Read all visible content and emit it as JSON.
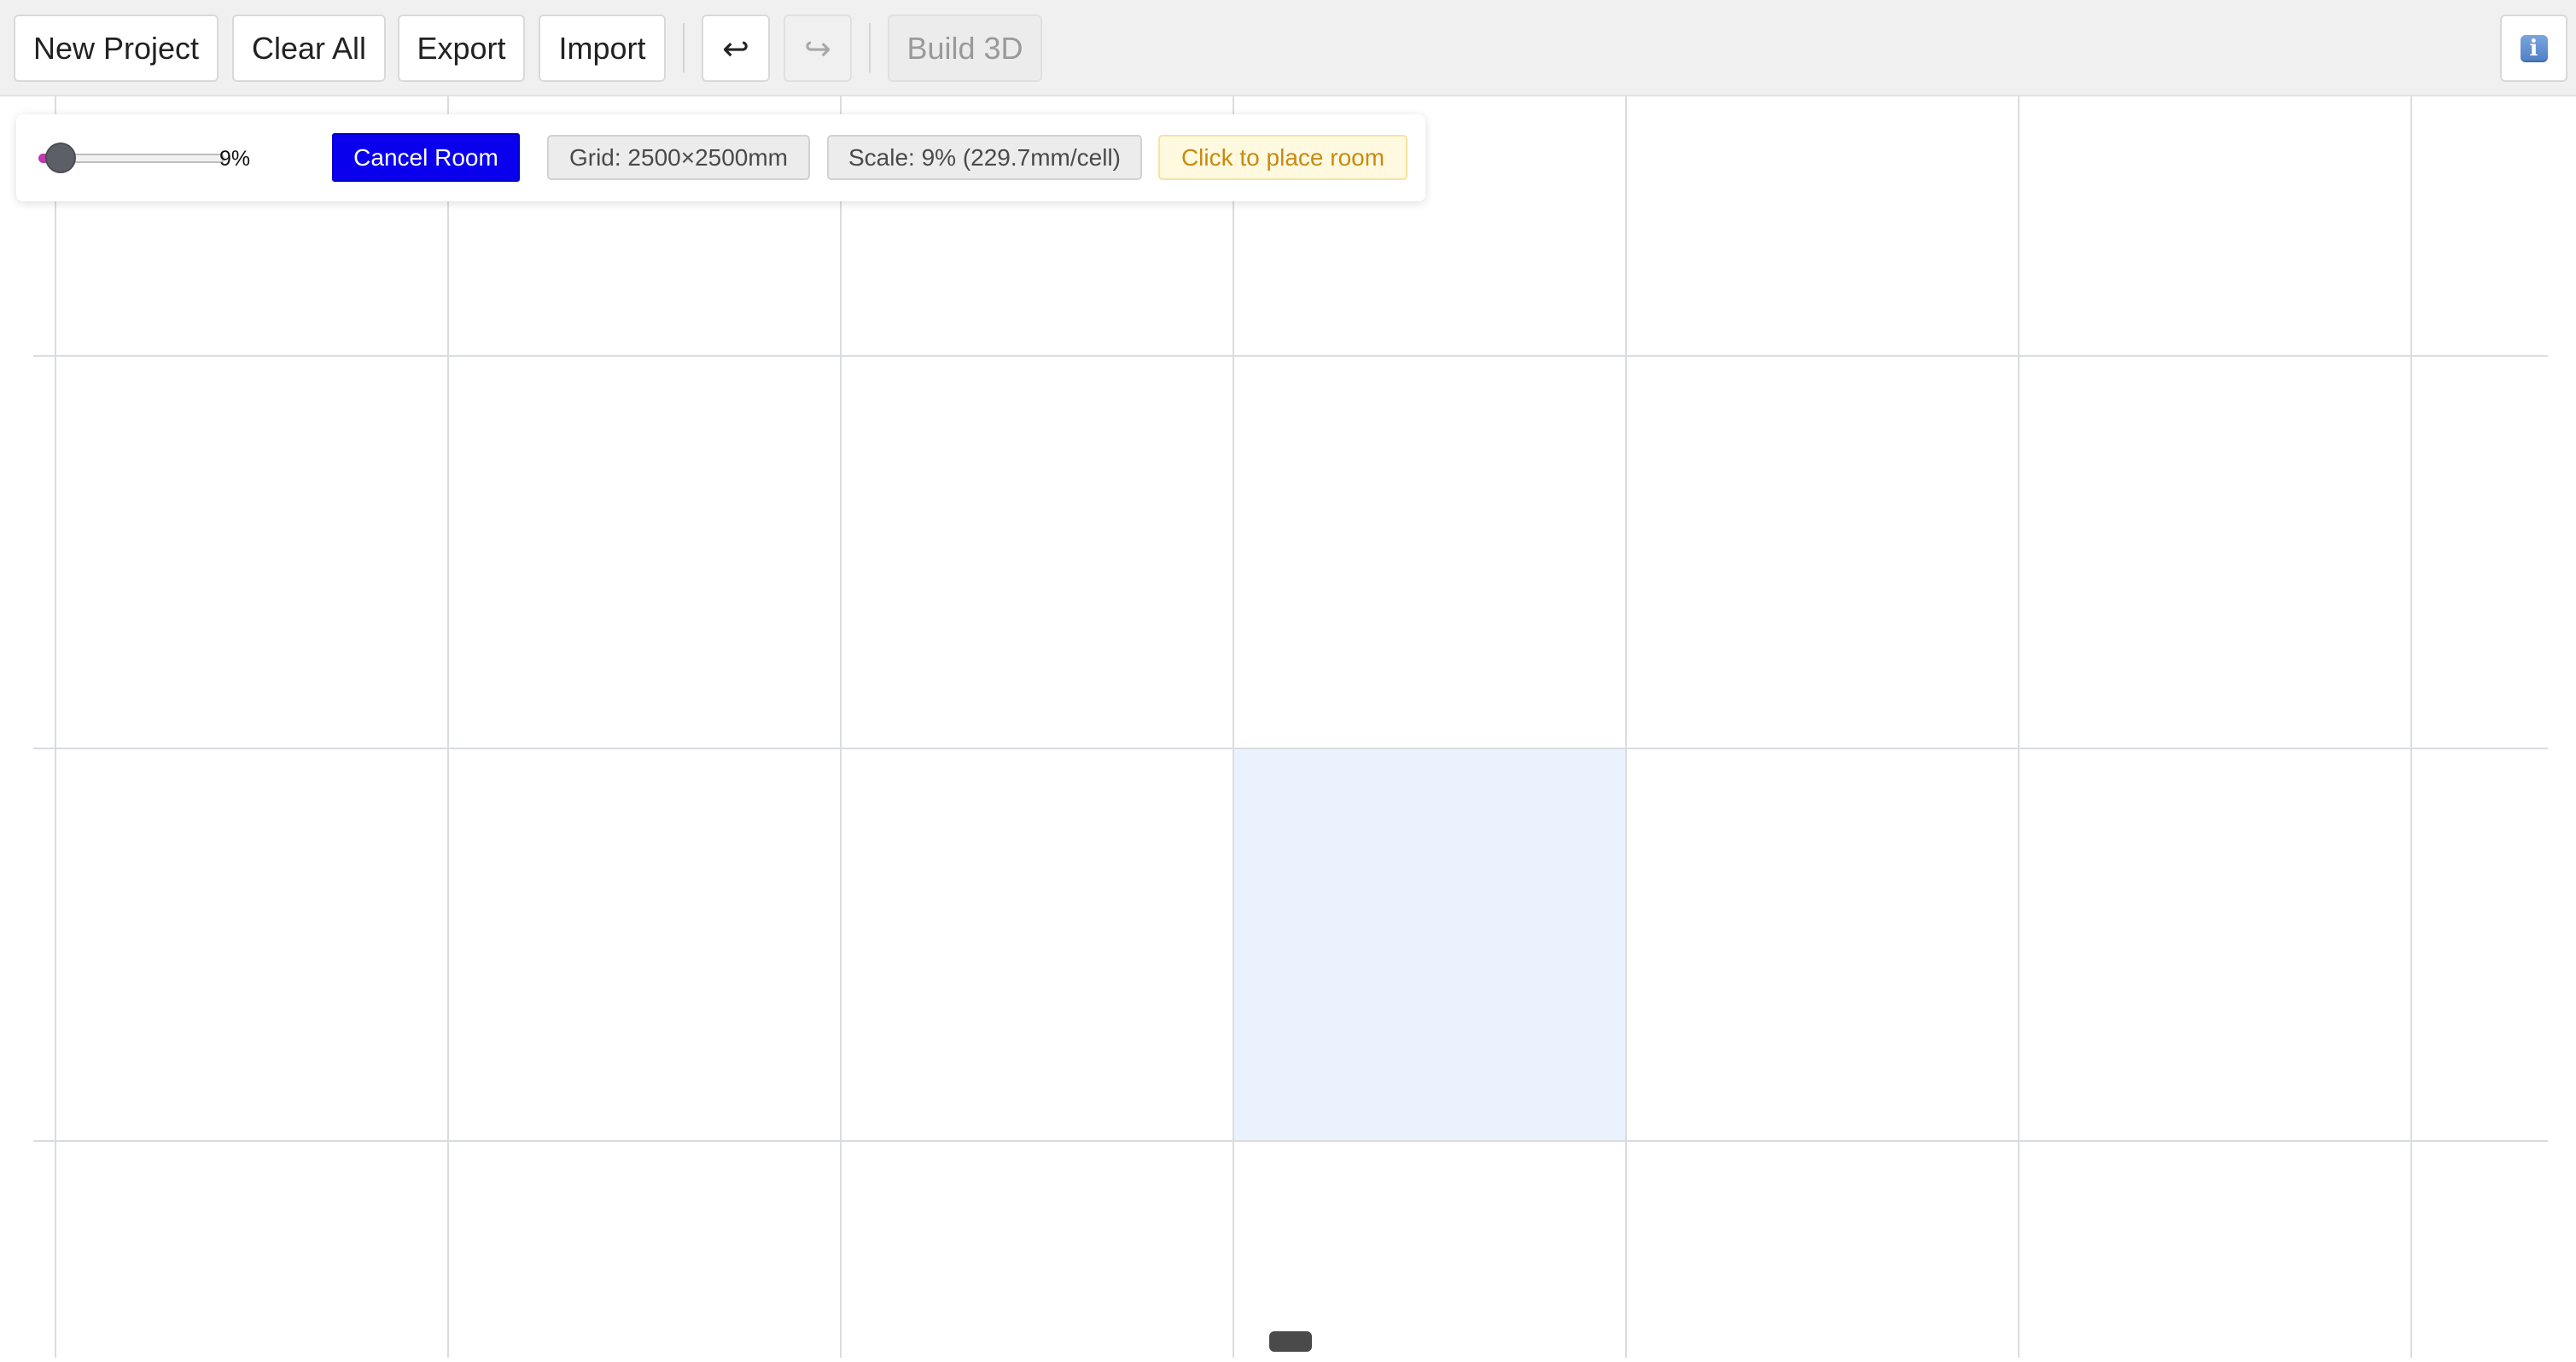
{
  "toolbar": {
    "new_project_label": "New Project",
    "clear_all_label": "Clear All",
    "export_label": "Export",
    "import_label": "Import",
    "undo_icon": "↩",
    "redo_icon": "↪",
    "build_3d_label": "Build 3D",
    "info_icon": "i"
  },
  "panel": {
    "zoom_percent": 9,
    "zoom_label": "9%",
    "cancel_room_label": "Cancel Room",
    "grid_chip": "Grid: 2500×2500mm",
    "scale_chip": "Scale: 9% (229.7mm/cell)",
    "hint_chip": "Click to place room"
  },
  "canvas": {
    "grid_columns_visible": 7,
    "grid_rows_visible": 4,
    "grid_line_color": "#d9dce0",
    "highlight_color": "#eaf3fd",
    "highlight_border_color": "#cfe0f3",
    "hover_cell": {
      "column": 4,
      "row": 3
    }
  },
  "colors": {
    "toolbar_bg": "#f0f0f0",
    "accent_blue": "#0a00ee",
    "hint_text": "#c98a12"
  }
}
